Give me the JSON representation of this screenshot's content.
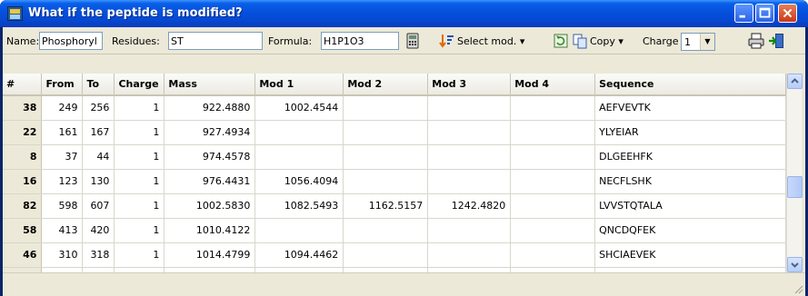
{
  "window": {
    "title": "What if the peptide is modified?"
  },
  "toolbar": {
    "name_label": "Name:",
    "name_value": "Phosphoryl",
    "residues_label": "Residues:",
    "residues_value": "ST",
    "formula_label": "Formula:",
    "formula_value": "H1P1O3",
    "select_mod_label": "Select mod.",
    "copy_label": "Copy",
    "charge_label": "Charge",
    "charge_value": "1",
    "icons": [
      "calculator-icon",
      "sort-icon",
      "refresh-icon",
      "copy-icon",
      "print-icon",
      "exit-icon"
    ]
  },
  "table": {
    "columns": [
      "#",
      "From",
      "To",
      "Charge",
      "Mass",
      "Mod 1",
      "Mod 2",
      "Mod 3",
      "Mod 4",
      "Sequence"
    ],
    "rows": [
      {
        "id": "38",
        "from": "249",
        "to": "256",
        "charge": "1",
        "mass": "922.4880",
        "mod1": "1002.4544",
        "mod2": "",
        "mod3": "",
        "mod4": "",
        "seq": "AEFVEVTK"
      },
      {
        "id": "22",
        "from": "161",
        "to": "167",
        "charge": "1",
        "mass": "927.4934",
        "mod1": "",
        "mod2": "",
        "mod3": "",
        "mod4": "",
        "seq": "YLYEIAR"
      },
      {
        "id": "8",
        "from": "37",
        "to": "44",
        "charge": "1",
        "mass": "974.4578",
        "mod1": "",
        "mod2": "",
        "mod3": "",
        "mod4": "",
        "seq": "DLGEEHFK"
      },
      {
        "id": "16",
        "from": "123",
        "to": "130",
        "charge": "1",
        "mass": "976.4431",
        "mod1": "1056.4094",
        "mod2": "",
        "mod3": "",
        "mod4": "",
        "seq": "NECFLSHK"
      },
      {
        "id": "82",
        "from": "598",
        "to": "607",
        "charge": "1",
        "mass": "1002.5830",
        "mod1": "1082.5493",
        "mod2": "1162.5157",
        "mod3": "1242.4820",
        "mod4": "",
        "seq": "LVVSTQTALA"
      },
      {
        "id": "58",
        "from": "413",
        "to": "420",
        "charge": "1",
        "mass": "1010.4122",
        "mod1": "",
        "mod2": "",
        "mod3": "",
        "mod4": "",
        "seq": "QNCDQFEK"
      },
      {
        "id": "46",
        "from": "310",
        "to": "318",
        "charge": "1",
        "mass": "1014.4799",
        "mod1": "1094.4462",
        "mod2": "",
        "mod3": "",
        "mod4": "",
        "seq": "SHCIAEVEK"
      }
    ]
  },
  "colors": {
    "titlebar": "#0550dc",
    "chrome": "#ece9d8",
    "grid_line": "#d8d6cc"
  }
}
